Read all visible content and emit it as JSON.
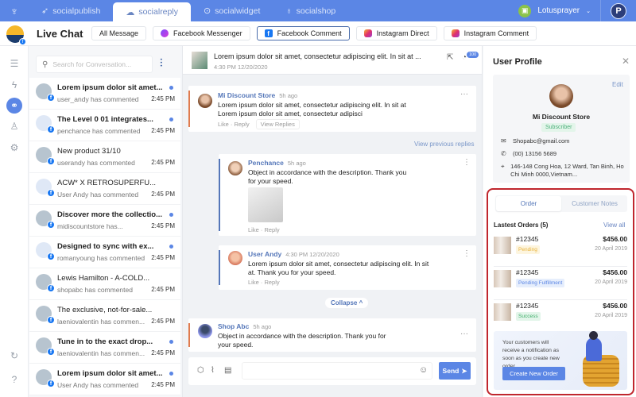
{
  "topbar": {
    "logo_icon": "antler-logo-icon",
    "tabs": [
      {
        "label": "socialpublish",
        "icon": "rocket-icon",
        "active": false
      },
      {
        "label": "socialreply",
        "icon": "chat-bubble-icon",
        "active": true
      },
      {
        "label": "socialwidget",
        "icon": "widget-icon",
        "active": false
      },
      {
        "label": "socialshop",
        "icon": "shop-bag-icon",
        "active": false
      }
    ],
    "store_name": "Lotusprayer",
    "avatar_letter": "P"
  },
  "header": {
    "title": "Live Chat",
    "filters": [
      {
        "label": "All Message",
        "icon": "",
        "active": false
      },
      {
        "label": "Facebook Messenger",
        "icon": "messenger-icon",
        "active": false
      },
      {
        "label": "Facebook Comment",
        "icon": "facebook-icon",
        "active": true
      },
      {
        "label": "Instagram Direct",
        "icon": "instagram-icon",
        "active": false
      },
      {
        "label": "Instagram Comment",
        "icon": "instagram-icon",
        "active": false
      }
    ]
  },
  "rail": {
    "items": [
      "document-icon",
      "bolt-icon",
      "sitemap-icon",
      "user-icon",
      "gear-icon"
    ],
    "bottom": [
      "refresh-chat-icon",
      "help-icon"
    ],
    "active_index": 2
  },
  "conversations": {
    "search_placeholder": "Search for Conversation...",
    "items": [
      {
        "title": "Lorem ipsum dolor sit amet...",
        "subtitle": "user_andy has commented",
        "time": "2:45 PM",
        "unread": true,
        "avatar": "photo"
      },
      {
        "title": "The Level 0 01 integrates...",
        "subtitle": "penchance has commented",
        "time": "2:45 PM",
        "unread": true,
        "avatar": "image"
      },
      {
        "title": "New product 31/10",
        "subtitle": "userandy has commented",
        "time": "2:45 PM",
        "unread": false,
        "avatar": "photo"
      },
      {
        "title": "ACW* X RETROSUPERFU...",
        "subtitle": "User Andy has commented",
        "time": "2:45 PM",
        "unread": false,
        "avatar": "image"
      },
      {
        "title": "Discover more the collectio...",
        "subtitle": "midiscountstore has...",
        "time": "2:45 PM",
        "unread": true,
        "avatar": "photo"
      },
      {
        "title": "Designed to sync with ex...",
        "subtitle": "romanyoung has commented",
        "time": "2:45 PM",
        "unread": true,
        "avatar": "image"
      },
      {
        "title": "Lewis Hamilton - A-COLD...",
        "subtitle": "shopabc has commented",
        "time": "2:45 PM",
        "unread": false,
        "avatar": "photo"
      },
      {
        "title": "The exclusive, not-for-sale...",
        "subtitle": "laeniovalentin has commen...",
        "time": "2:45 PM",
        "unread": false,
        "avatar": "photo"
      },
      {
        "title": "Tune in to the exact drop...",
        "subtitle": "laeniovalentin has commen...",
        "time": "2:45 PM",
        "unread": true,
        "avatar": "photo"
      },
      {
        "title": "Lorem ipsum dolor sit amet...",
        "subtitle": "User Andy has commented",
        "time": "2:45 PM",
        "unread": true,
        "avatar": "photo"
      }
    ]
  },
  "chat": {
    "post": {
      "text": "Lorem ipsum dolor sit amet, consectetur adipiscing elit. In sit at ...",
      "datetime": "4:30 PM 12/20/2020",
      "badge": "100"
    },
    "comments": [
      {
        "name": "Mi Discount Store",
        "time": "5h ago",
        "text": "Lorem ipsum dolor sit amet, consectetur adipiscing elit. In sit at Lorem ipsum dolor sit amet, consectetur adipisci",
        "like": "Like",
        "reply": "Reply",
        "view_replies": "View Replies"
      },
      {
        "name": "Penchance",
        "time": "5h ago",
        "text": "Object in accordance with the description. Thank you for your speed.",
        "like": "Like",
        "reply": "Reply"
      },
      {
        "name": "User Andy",
        "time": "4:30 PM 12/20/2020",
        "text": "Lorem ipsum dolor sit amet, consectetur adipiscing elit. In sit at. Thank you for your speed.",
        "like": "Like",
        "reply": "Reply"
      },
      {
        "name": "Shop Abc",
        "time": "5h ago",
        "text": "Object in accordance with the description. Thank you for your speed."
      }
    ],
    "view_previous": "View previous replies",
    "collapse": "Collapse ^",
    "composer": {
      "placeholder": "",
      "send": "Send"
    }
  },
  "profile": {
    "title": "User Profile",
    "edit": "Edit",
    "name": "Mi Discount Store",
    "tag": "Subscriber",
    "email": "Shopabc@gmail.com",
    "phone": "(00) 13156 5689",
    "address": "146-148 Cong Hoa, 12 Ward, Tan Binh, Ho Chi Minh 0000,Vietnam..."
  },
  "orders": {
    "tabs": [
      "Order",
      "Customer Notes"
    ],
    "active_tab": 0,
    "heading": "Lastest Orders (5)",
    "view_all": "View all",
    "items": [
      {
        "id": "#12345",
        "status": "Pending",
        "price": "$456.00",
        "date": "20 April 2019",
        "status_color": "#e8b33c",
        "status_bg": "#fdf5df"
      },
      {
        "id": "#12345",
        "status": "Pending Fulfillment",
        "price": "$456.00",
        "date": "20 April 2019",
        "status_color": "#5b86e5",
        "status_bg": "#e6eefc"
      },
      {
        "id": "#12345",
        "status": "Success",
        "price": "$456.00",
        "date": "20 April 2019",
        "status_color": "#3fae6a",
        "status_bg": "#e3f5ea"
      }
    ],
    "promo_text": "Your customers will receive a notification as soon as you create new order",
    "create_button": "Create New Order"
  }
}
